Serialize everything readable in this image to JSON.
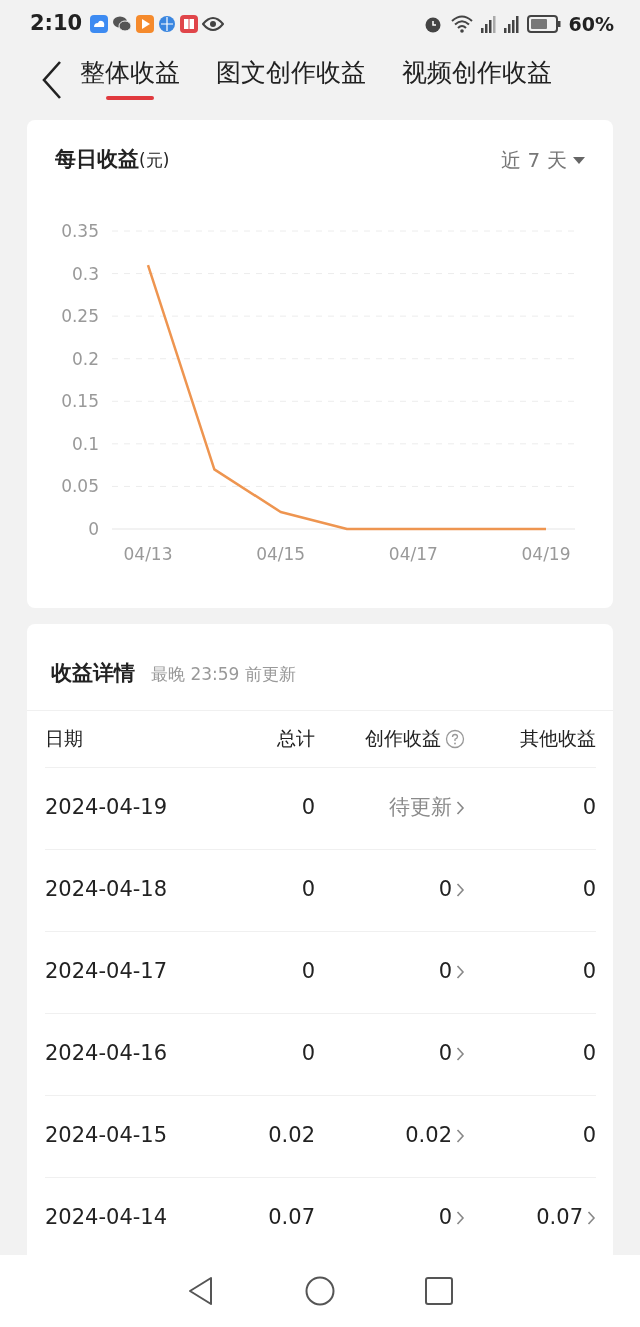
{
  "status_bar": {
    "time": "2:10",
    "battery": "60%"
  },
  "tabs": [
    {
      "label": "整体收益",
      "selected": true
    },
    {
      "label": "图文创作收益",
      "selected": false
    },
    {
      "label": "视频创作收益",
      "selected": false
    }
  ],
  "daily_card": {
    "title": "每日收益",
    "unit": "(元)",
    "range": "近 7 天",
    "chart_data": {
      "type": "line",
      "categories": [
        "04/13",
        null,
        "04/15",
        null,
        "04/17",
        null,
        "04/19"
      ],
      "series": [
        {
          "color": "#ee9550",
          "values": [
            0.31,
            0.07,
            0.02,
            0,
            0,
            0,
            0
          ]
        }
      ],
      "ylim": [
        0,
        0.35
      ],
      "yticks": [
        0,
        0.05,
        0.1,
        0.15,
        0.2,
        0.25,
        0.3,
        0.35
      ],
      "grid": true
    }
  },
  "details": {
    "title": "收益详情",
    "note": "最晚 23:59 前更新",
    "columns": [
      "日期",
      "总计",
      "创作收益",
      "其他收益"
    ],
    "rows": [
      {
        "date": "2024-04-19",
        "total": "0",
        "creation": {
          "text": "待更新",
          "pending": true,
          "link": true
        },
        "other": {
          "text": "0",
          "link": false
        }
      },
      {
        "date": "2024-04-18",
        "total": "0",
        "creation": {
          "text": "0",
          "pending": false,
          "link": true
        },
        "other": {
          "text": "0",
          "link": false
        }
      },
      {
        "date": "2024-04-17",
        "total": "0",
        "creation": {
          "text": "0",
          "pending": false,
          "link": true
        },
        "other": {
          "text": "0",
          "link": false
        }
      },
      {
        "date": "2024-04-16",
        "total": "0",
        "creation": {
          "text": "0",
          "pending": false,
          "link": true
        },
        "other": {
          "text": "0",
          "link": false
        }
      },
      {
        "date": "2024-04-15",
        "total": "0.02",
        "creation": {
          "text": "0.02",
          "pending": false,
          "link": true
        },
        "other": {
          "text": "0",
          "link": false
        }
      },
      {
        "date": "2024-04-14",
        "total": "0.07",
        "creation": {
          "text": "0",
          "pending": false,
          "link": true
        },
        "other": {
          "text": "0.07",
          "link": true
        }
      }
    ]
  }
}
